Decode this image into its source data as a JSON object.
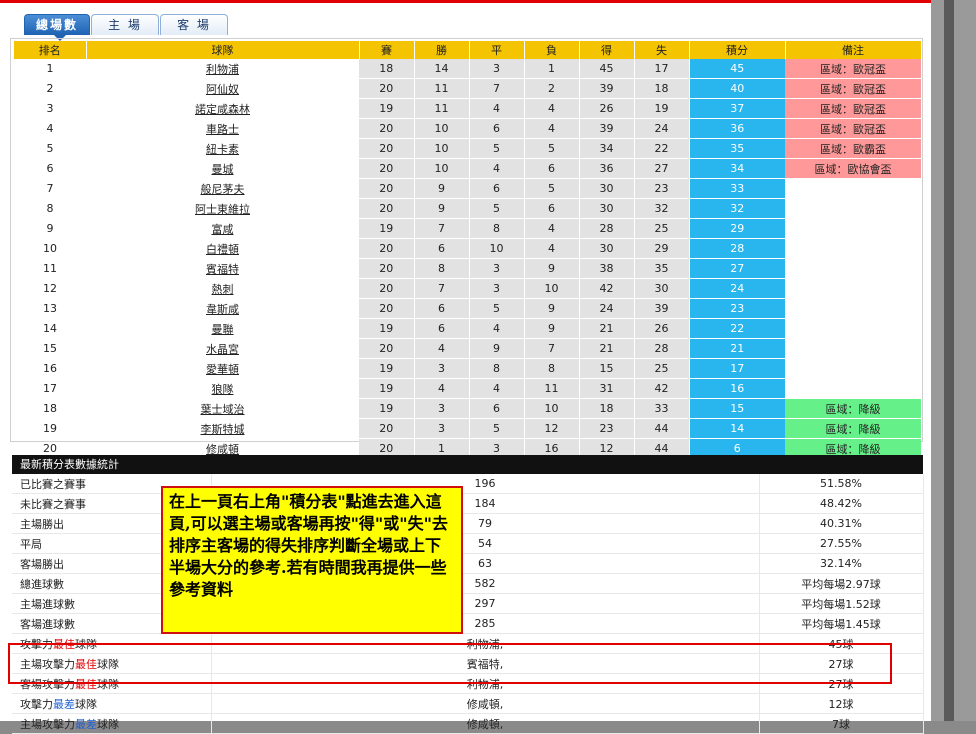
{
  "tabs": [
    {
      "label": "總場數",
      "active": true
    },
    {
      "label": "主 場",
      "active": false
    },
    {
      "label": "客 場",
      "active": false
    }
  ],
  "league_headers": [
    "排名",
    "球隊",
    "賽",
    "勝",
    "平",
    "負",
    "得",
    "失",
    "積分",
    "備注"
  ],
  "league_rows": [
    {
      "rank": "1",
      "team": "利物浦",
      "p": "18",
      "w": "14",
      "d": "3",
      "l": "1",
      "gf": "45",
      "ga": "17",
      "pts": "45",
      "note": "區域：歐冠盃",
      "note_type": "red"
    },
    {
      "rank": "2",
      "team": "阿仙奴",
      "p": "20",
      "w": "11",
      "d": "7",
      "l": "2",
      "gf": "39",
      "ga": "18",
      "pts": "40",
      "note": "區域：歐冠盃",
      "note_type": "red"
    },
    {
      "rank": "3",
      "team": "諾定咸森林",
      "p": "19",
      "w": "11",
      "d": "4",
      "l": "4",
      "gf": "26",
      "ga": "19",
      "pts": "37",
      "note": "區域：歐冠盃",
      "note_type": "red"
    },
    {
      "rank": "4",
      "team": "車路士",
      "p": "20",
      "w": "10",
      "d": "6",
      "l": "4",
      "gf": "39",
      "ga": "24",
      "pts": "36",
      "note": "區域：歐冠盃",
      "note_type": "red"
    },
    {
      "rank": "5",
      "team": "紐卡素",
      "p": "20",
      "w": "10",
      "d": "5",
      "l": "5",
      "gf": "34",
      "ga": "22",
      "pts": "35",
      "note": "區域：歐霸盃",
      "note_type": "red"
    },
    {
      "rank": "6",
      "team": "曼城",
      "p": "20",
      "w": "10",
      "d": "4",
      "l": "6",
      "gf": "36",
      "ga": "27",
      "pts": "34",
      "note": "區域：歐協會盃",
      "note_type": "red"
    },
    {
      "rank": "7",
      "team": "般尼茅夫",
      "p": "20",
      "w": "9",
      "d": "6",
      "l": "5",
      "gf": "30",
      "ga": "23",
      "pts": "33",
      "note": "",
      "note_type": "empty"
    },
    {
      "rank": "8",
      "team": "阿士東維拉",
      "p": "20",
      "w": "9",
      "d": "5",
      "l": "6",
      "gf": "30",
      "ga": "32",
      "pts": "32",
      "note": "",
      "note_type": "empty"
    },
    {
      "rank": "9",
      "team": "富咸",
      "p": "19",
      "w": "7",
      "d": "8",
      "l": "4",
      "gf": "28",
      "ga": "25",
      "pts": "29",
      "note": "",
      "note_type": "empty"
    },
    {
      "rank": "10",
      "team": "白禮頓",
      "p": "20",
      "w": "6",
      "d": "10",
      "l": "4",
      "gf": "30",
      "ga": "29",
      "pts": "28",
      "note": "",
      "note_type": "empty"
    },
    {
      "rank": "11",
      "team": "賓福特",
      "p": "20",
      "w": "8",
      "d": "3",
      "l": "9",
      "gf": "38",
      "ga": "35",
      "pts": "27",
      "note": "",
      "note_type": "empty"
    },
    {
      "rank": "12",
      "team": "熱刺",
      "p": "20",
      "w": "7",
      "d": "3",
      "l": "10",
      "gf": "42",
      "ga": "30",
      "pts": "24",
      "note": "",
      "note_type": "empty"
    },
    {
      "rank": "13",
      "team": "韋斯咸",
      "p": "20",
      "w": "6",
      "d": "5",
      "l": "9",
      "gf": "24",
      "ga": "39",
      "pts": "23",
      "note": "",
      "note_type": "empty"
    },
    {
      "rank": "14",
      "team": "曼聯",
      "p": "19",
      "w": "6",
      "d": "4",
      "l": "9",
      "gf": "21",
      "ga": "26",
      "pts": "22",
      "note": "",
      "note_type": "empty"
    },
    {
      "rank": "15",
      "team": "水晶宮",
      "p": "20",
      "w": "4",
      "d": "9",
      "l": "7",
      "gf": "21",
      "ga": "28",
      "pts": "21",
      "note": "",
      "note_type": "empty"
    },
    {
      "rank": "16",
      "team": "愛華頓",
      "p": "19",
      "w": "3",
      "d": "8",
      "l": "8",
      "gf": "15",
      "ga": "25",
      "pts": "17",
      "note": "",
      "note_type": "empty"
    },
    {
      "rank": "17",
      "team": "狼隊",
      "p": "19",
      "w": "4",
      "d": "4",
      "l": "11",
      "gf": "31",
      "ga": "42",
      "pts": "16",
      "note": "",
      "note_type": "empty"
    },
    {
      "rank": "18",
      "team": "葉士域治",
      "p": "19",
      "w": "3",
      "d": "6",
      "l": "10",
      "gf": "18",
      "ga": "33",
      "pts": "15",
      "note": "區域：降級",
      "note_type": "green"
    },
    {
      "rank": "19",
      "team": "李斯特城",
      "p": "20",
      "w": "3",
      "d": "5",
      "l": "12",
      "gf": "23",
      "ga": "44",
      "pts": "14",
      "note": "區域：降級",
      "note_type": "green"
    },
    {
      "rank": "20",
      "team": "修咸頓",
      "p": "20",
      "w": "1",
      "d": "3",
      "l": "16",
      "gf": "12",
      "ga": "44",
      "pts": "6",
      "note": "區域：降級",
      "note_type": "green"
    }
  ],
  "stats_title": "最新積分表數據統計",
  "stats_rows": [
    {
      "pre": "已比賽之賽事",
      "hl": "",
      "hl_color": "",
      "post": "",
      "value": "196",
      "pct": "51.58%"
    },
    {
      "pre": "未比賽之賽事",
      "hl": "",
      "hl_color": "",
      "post": "",
      "value": "184",
      "pct": "48.42%"
    },
    {
      "pre": "主場勝出",
      "hl": "",
      "hl_color": "",
      "post": "",
      "value": "79",
      "pct": "40.31%"
    },
    {
      "pre": "平局",
      "hl": "",
      "hl_color": "",
      "post": "",
      "value": "54",
      "pct": "27.55%"
    },
    {
      "pre": "客場勝出",
      "hl": "",
      "hl_color": "",
      "post": "",
      "value": "63",
      "pct": "32.14%"
    },
    {
      "pre": "總進球數",
      "hl": "",
      "hl_color": "",
      "post": "",
      "value": "582",
      "pct": "平均每場2.97球"
    },
    {
      "pre": "主場進球數",
      "hl": "",
      "hl_color": "",
      "post": "",
      "value": "297",
      "pct": "平均每場1.52球"
    },
    {
      "pre": "客場進球數",
      "hl": "",
      "hl_color": "",
      "post": "",
      "value": "285",
      "pct": "平均每場1.45球"
    },
    {
      "pre": "攻擊力",
      "hl": "最佳",
      "hl_color": "red",
      "post": "球隊",
      "value": "利物浦,",
      "pct": "45球"
    },
    {
      "pre": "主場攻擊力",
      "hl": "最佳",
      "hl_color": "red",
      "post": "球隊",
      "value": "賓福特,",
      "pct": "27球"
    },
    {
      "pre": "客場攻擊力",
      "hl": "最佳",
      "hl_color": "red",
      "post": "球隊",
      "value": "利物浦,",
      "pct": "27球"
    },
    {
      "pre": "攻擊力",
      "hl": "最差",
      "hl_color": "blue",
      "post": "球隊",
      "value": "修咸頓,",
      "pct": "12球"
    },
    {
      "pre": "主場攻擊力",
      "hl": "最差",
      "hl_color": "blue",
      "post": "球隊",
      "value": "修咸頓,",
      "pct": "7球"
    }
  ],
  "callout_text": "在上一頁右上角\"積分表\"點進去進入這頁,可以選主場或客場再按\"得\"或\"失\"去排序主客場的得失排序判斷全場或上下半場大分的參考.若有時間我再提供一些參考資料",
  "colors": {
    "header_yellow": "#f5c400",
    "points_blue": "#29b6ee",
    "note_red": "#ff9999",
    "note_green": "#66f089",
    "callout_yellow": "#ffff00"
  }
}
